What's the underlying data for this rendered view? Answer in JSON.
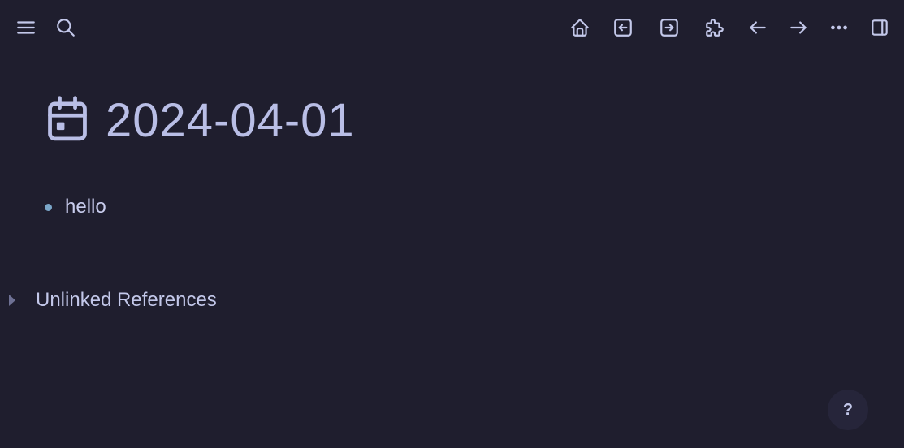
{
  "toolbar": {
    "left": [
      {
        "name": "menu-icon",
        "label": "Menu"
      },
      {
        "name": "search-icon",
        "label": "Search"
      }
    ],
    "right": [
      {
        "name": "home-icon",
        "label": "Home"
      },
      {
        "name": "arrow-left-box-icon",
        "label": "Back"
      },
      {
        "name": "arrow-right-box-icon",
        "label": "Forward"
      },
      {
        "name": "puzzle-icon",
        "label": "Plugins"
      },
      {
        "name": "arrow-left-icon",
        "label": "Navigate back"
      },
      {
        "name": "arrow-right-icon",
        "label": "Navigate forward"
      },
      {
        "name": "more-icon",
        "label": "More"
      },
      {
        "name": "sidebar-toggle-icon",
        "label": "Toggle right sidebar"
      }
    ]
  },
  "page": {
    "icon": "calendar-icon",
    "title": "2024-04-01",
    "blocks": [
      {
        "text": "hello"
      }
    ],
    "unlinked_references_label": "Unlinked References"
  },
  "help": {
    "label": "?"
  },
  "colors": {
    "background": "#1f1e2e",
    "text": "#c3c8ea",
    "bullet": "#7aa6c8"
  }
}
